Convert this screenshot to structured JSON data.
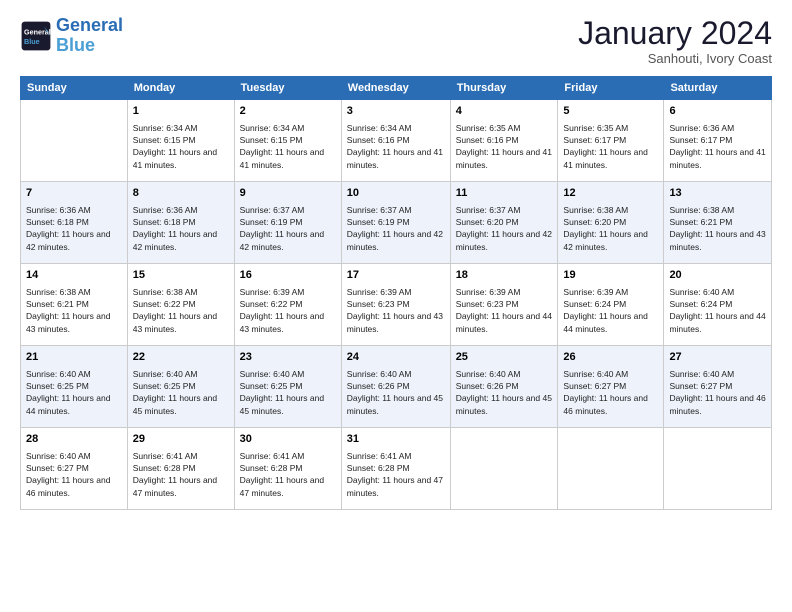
{
  "logo": {
    "line1": "General",
    "line2": "Blue"
  },
  "title": "January 2024",
  "subtitle": "Sanhouti, Ivory Coast",
  "days_header": [
    "Sunday",
    "Monday",
    "Tuesday",
    "Wednesday",
    "Thursday",
    "Friday",
    "Saturday"
  ],
  "weeks": [
    [
      {
        "day": "",
        "sunrise": "",
        "sunset": "",
        "daylight": ""
      },
      {
        "day": "1",
        "sunrise": "6:34 AM",
        "sunset": "6:15 PM",
        "daylight": "11 hours and 41 minutes."
      },
      {
        "day": "2",
        "sunrise": "6:34 AM",
        "sunset": "6:15 PM",
        "daylight": "11 hours and 41 minutes."
      },
      {
        "day": "3",
        "sunrise": "6:34 AM",
        "sunset": "6:16 PM",
        "daylight": "11 hours and 41 minutes."
      },
      {
        "day": "4",
        "sunrise": "6:35 AM",
        "sunset": "6:16 PM",
        "daylight": "11 hours and 41 minutes."
      },
      {
        "day": "5",
        "sunrise": "6:35 AM",
        "sunset": "6:17 PM",
        "daylight": "11 hours and 41 minutes."
      },
      {
        "day": "6",
        "sunrise": "6:36 AM",
        "sunset": "6:17 PM",
        "daylight": "11 hours and 41 minutes."
      }
    ],
    [
      {
        "day": "7",
        "sunrise": "6:36 AM",
        "sunset": "6:18 PM",
        "daylight": "11 hours and 42 minutes."
      },
      {
        "day": "8",
        "sunrise": "6:36 AM",
        "sunset": "6:18 PM",
        "daylight": "11 hours and 42 minutes."
      },
      {
        "day": "9",
        "sunrise": "6:37 AM",
        "sunset": "6:19 PM",
        "daylight": "11 hours and 42 minutes."
      },
      {
        "day": "10",
        "sunrise": "6:37 AM",
        "sunset": "6:19 PM",
        "daylight": "11 hours and 42 minutes."
      },
      {
        "day": "11",
        "sunrise": "6:37 AM",
        "sunset": "6:20 PM",
        "daylight": "11 hours and 42 minutes."
      },
      {
        "day": "12",
        "sunrise": "6:38 AM",
        "sunset": "6:20 PM",
        "daylight": "11 hours and 42 minutes."
      },
      {
        "day": "13",
        "sunrise": "6:38 AM",
        "sunset": "6:21 PM",
        "daylight": "11 hours and 43 minutes."
      }
    ],
    [
      {
        "day": "14",
        "sunrise": "6:38 AM",
        "sunset": "6:21 PM",
        "daylight": "11 hours and 43 minutes."
      },
      {
        "day": "15",
        "sunrise": "6:38 AM",
        "sunset": "6:22 PM",
        "daylight": "11 hours and 43 minutes."
      },
      {
        "day": "16",
        "sunrise": "6:39 AM",
        "sunset": "6:22 PM",
        "daylight": "11 hours and 43 minutes."
      },
      {
        "day": "17",
        "sunrise": "6:39 AM",
        "sunset": "6:23 PM",
        "daylight": "11 hours and 43 minutes."
      },
      {
        "day": "18",
        "sunrise": "6:39 AM",
        "sunset": "6:23 PM",
        "daylight": "11 hours and 44 minutes."
      },
      {
        "day": "19",
        "sunrise": "6:39 AM",
        "sunset": "6:24 PM",
        "daylight": "11 hours and 44 minutes."
      },
      {
        "day": "20",
        "sunrise": "6:40 AM",
        "sunset": "6:24 PM",
        "daylight": "11 hours and 44 minutes."
      }
    ],
    [
      {
        "day": "21",
        "sunrise": "6:40 AM",
        "sunset": "6:25 PM",
        "daylight": "11 hours and 44 minutes."
      },
      {
        "day": "22",
        "sunrise": "6:40 AM",
        "sunset": "6:25 PM",
        "daylight": "11 hours and 45 minutes."
      },
      {
        "day": "23",
        "sunrise": "6:40 AM",
        "sunset": "6:25 PM",
        "daylight": "11 hours and 45 minutes."
      },
      {
        "day": "24",
        "sunrise": "6:40 AM",
        "sunset": "6:26 PM",
        "daylight": "11 hours and 45 minutes."
      },
      {
        "day": "25",
        "sunrise": "6:40 AM",
        "sunset": "6:26 PM",
        "daylight": "11 hours and 45 minutes."
      },
      {
        "day": "26",
        "sunrise": "6:40 AM",
        "sunset": "6:27 PM",
        "daylight": "11 hours and 46 minutes."
      },
      {
        "day": "27",
        "sunrise": "6:40 AM",
        "sunset": "6:27 PM",
        "daylight": "11 hours and 46 minutes."
      }
    ],
    [
      {
        "day": "28",
        "sunrise": "6:40 AM",
        "sunset": "6:27 PM",
        "daylight": "11 hours and 46 minutes."
      },
      {
        "day": "29",
        "sunrise": "6:41 AM",
        "sunset": "6:28 PM",
        "daylight": "11 hours and 47 minutes."
      },
      {
        "day": "30",
        "sunrise": "6:41 AM",
        "sunset": "6:28 PM",
        "daylight": "11 hours and 47 minutes."
      },
      {
        "day": "31",
        "sunrise": "6:41 AM",
        "sunset": "6:28 PM",
        "daylight": "11 hours and 47 minutes."
      },
      {
        "day": "",
        "sunrise": "",
        "sunset": "",
        "daylight": ""
      },
      {
        "day": "",
        "sunrise": "",
        "sunset": "",
        "daylight": ""
      },
      {
        "day": "",
        "sunrise": "",
        "sunset": "",
        "daylight": ""
      }
    ]
  ]
}
